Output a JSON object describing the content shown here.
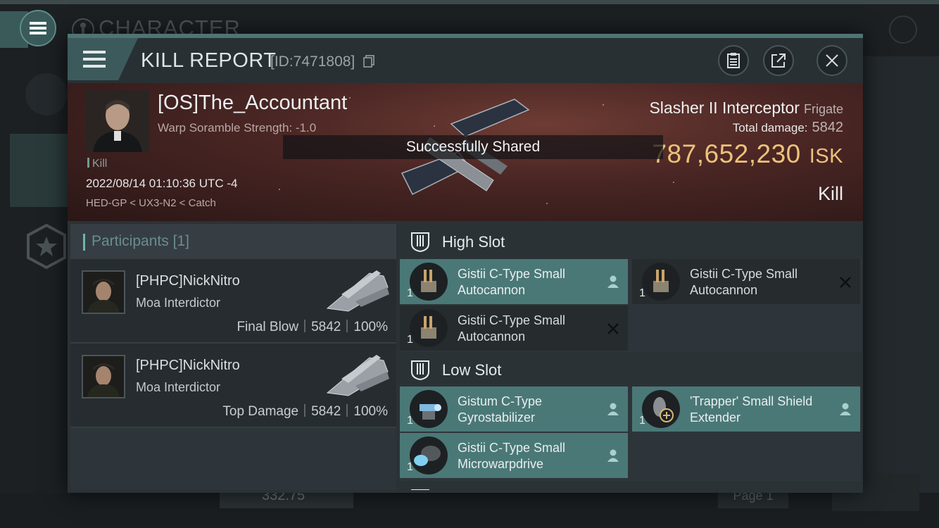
{
  "background": {
    "title": "CHARACTER",
    "isk_fragment": "332.75",
    "page_label": "Page 1"
  },
  "window": {
    "title": "KILL REPORT",
    "id_label": "[ID:7471808]"
  },
  "victim": {
    "name": "[OS]The_Accountant",
    "warp_scramble": "Warp Soramble Strength: -1.0",
    "kill_tag": "Kill",
    "datetime": "2022/08/14 01:10:36 UTC -4",
    "location": "HED-GP < UX3-N2 < Catch",
    "ship_name": "Slasher II Interceptor",
    "ship_class": "Frigate",
    "total_damage_label": "Total damage:",
    "total_damage": "5842",
    "isk_value": "787,652,230",
    "isk_unit": "ISK",
    "result": "Kill"
  },
  "toast": "Successfully Shared",
  "participants": {
    "label": "Participants",
    "count": "[1]",
    "rows": [
      {
        "name": "[PHPC]NickNitro",
        "ship": "Moa Interdictor",
        "role": "Final Blow",
        "damage": "5842",
        "percent": "100%"
      },
      {
        "name": "[PHPC]NickNitro",
        "ship": "Moa Interdictor",
        "role": "Top Damage",
        "damage": "5842",
        "percent": "100%"
      }
    ]
  },
  "fitting": {
    "high_slot_label": "High Slot",
    "low_slot_label": "Low Slot",
    "high_slot": [
      {
        "name": "Gistii C-Type Small Autocannon",
        "qty": "1",
        "status": "dropped"
      },
      {
        "name": "Gistii C-Type Small Autocannon",
        "qty": "1",
        "status": "destroyed"
      },
      {
        "name": "Gistii C-Type Small Autocannon",
        "qty": "1",
        "status": "destroyed"
      }
    ],
    "low_slot": [
      {
        "name": "Gistum C-Type Gyrostabilizer",
        "qty": "1",
        "status": "dropped"
      },
      {
        "name": "'Trapper' Small Shield Extender",
        "qty": "1",
        "status": "dropped"
      },
      {
        "name": "Gistii C-Type Small Microwarpdrive",
        "qty": "1",
        "status": "dropped"
      }
    ]
  },
  "colors": {
    "accent": "#4f7473",
    "isk_gold": "#ecc27a",
    "dropped_highlight": "#4a7877"
  }
}
